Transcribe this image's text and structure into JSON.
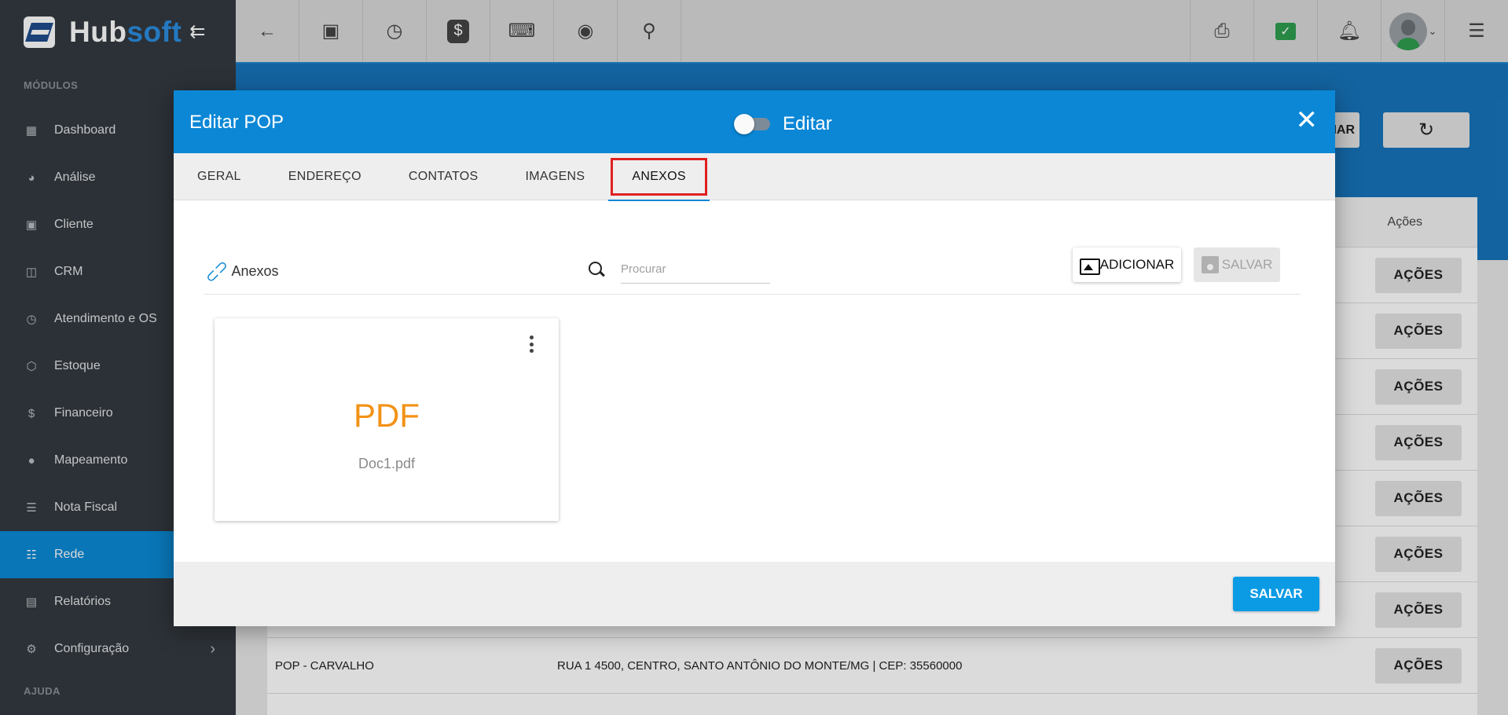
{
  "app": {
    "logo_main": "Hub",
    "logo_accent": "soft"
  },
  "sidebar": {
    "section_modules": "MÓDULOS",
    "section_help": "AJUDA",
    "items": [
      {
        "label": "Dashboard",
        "icon": "dashboard-icon"
      },
      {
        "label": "Análise",
        "icon": "pie-chart-icon"
      },
      {
        "label": "Cliente",
        "icon": "contact-card-icon"
      },
      {
        "label": "CRM",
        "icon": "crm-board-icon"
      },
      {
        "label": "Atendimento e OS",
        "icon": "calendar-clock-icon"
      },
      {
        "label": "Estoque",
        "icon": "box-icon"
      },
      {
        "label": "Financeiro",
        "icon": "money-icon"
      },
      {
        "label": "Mapeamento",
        "icon": "map-pin-icon"
      },
      {
        "label": "Nota Fiscal",
        "icon": "receipt-icon"
      },
      {
        "label": "Rede",
        "icon": "network-server-icon",
        "active": true
      },
      {
        "label": "Relatórios",
        "icon": "report-icon"
      },
      {
        "label": "Configuração",
        "icon": "gear-icon"
      }
    ]
  },
  "topbar": {
    "left_icons": [
      "back-arrow-icon",
      "contact-card-icon",
      "calendar-clock-icon",
      "dollar-icon",
      "terminal-icon",
      "eye-icon",
      "search-icon"
    ],
    "right_icons": [
      "pdf-icon",
      "check-icon",
      "bell-icon",
      "avatar",
      "menu-icon"
    ]
  },
  "background": {
    "partial_button": "NAR",
    "table_header_actions": "Ações",
    "rows": [
      {
        "name": "",
        "address": ""
      },
      {
        "name": "",
        "address": ""
      },
      {
        "name": "",
        "address": ""
      },
      {
        "name": "",
        "address": ""
      },
      {
        "name": "",
        "address": ""
      },
      {
        "name": "",
        "address": ""
      },
      {
        "name": "",
        "address": ""
      },
      {
        "name": "POP - CARVALHO",
        "address": "RUA 1 4500, CENTRO, SANTO ANTÔNIO DO MONTE/MG | CEP: 35560000"
      }
    ],
    "actions_label": "AÇÕES"
  },
  "modal": {
    "title": "Editar POP",
    "toggle_label": "Editar",
    "tabs": [
      "GERAL",
      "ENDEREÇO",
      "CONTATOS",
      "IMAGENS",
      "ANEXOS"
    ],
    "active_tab": "ANEXOS",
    "attachments_title": "Anexos",
    "search_placeholder": "Procurar",
    "add_button": "ADICIONAR",
    "save_disabled_button": "SALVAR",
    "file": {
      "type": "PDF",
      "name": "Doc1.pdf"
    },
    "footer_save": "SALVAR"
  },
  "colors": {
    "primary": "#0b87d6",
    "sidebar": "#343a40",
    "pdf_orange": "#f39216",
    "highlight_red": "#e02020"
  }
}
